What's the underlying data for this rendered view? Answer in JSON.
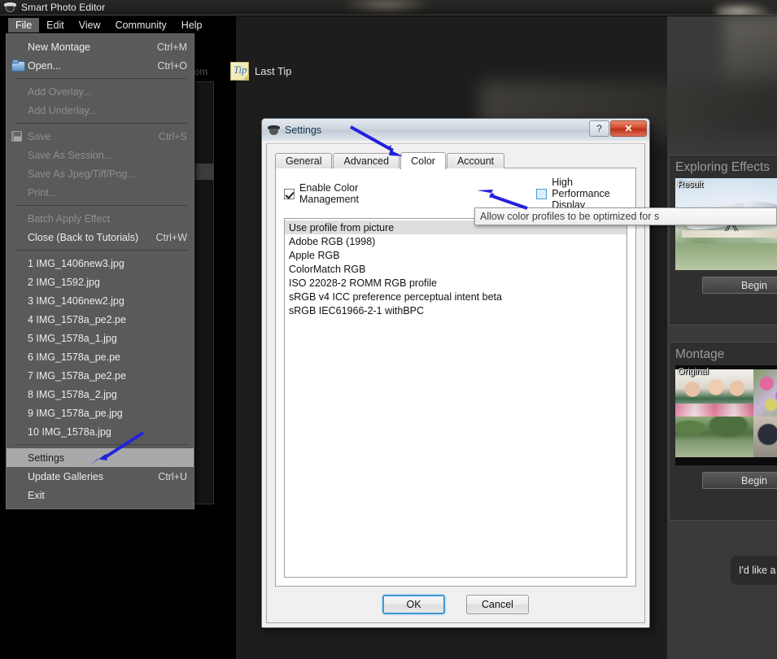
{
  "app": {
    "title": "Smart Photo Editor",
    "icon": "camera-icon"
  },
  "menubar": {
    "items": [
      {
        "label": "File",
        "active": true
      },
      {
        "label": "Edit",
        "active": false
      },
      {
        "label": "View",
        "active": false
      },
      {
        "label": "Community",
        "active": false
      },
      {
        "label": "Help",
        "active": false
      }
    ]
  },
  "toolbar": {
    "zoom_label": "oom",
    "tip_icon_glyph": "Tip",
    "last_tip_label": "Last Tip"
  },
  "file_menu": {
    "groups": [
      {
        "items": [
          {
            "label": "New Montage",
            "accel": "Ctrl+M",
            "icon": "",
            "disabled": false
          },
          {
            "label": "Open...",
            "accel": "Ctrl+O",
            "icon": "folder-open-icon",
            "disabled": false
          }
        ]
      },
      {
        "items": [
          {
            "label": "Add Overlay...",
            "accel": "",
            "icon": "",
            "disabled": true
          },
          {
            "label": "Add Underlay...",
            "accel": "",
            "icon": "",
            "disabled": true
          }
        ]
      },
      {
        "items": [
          {
            "label": "Save",
            "accel": "Ctrl+S",
            "icon": "save-icon",
            "disabled": true
          },
          {
            "label": "Save As Session...",
            "accel": "",
            "icon": "",
            "disabled": true
          },
          {
            "label": "Save As Jpeg/Tiff/Png...",
            "accel": "",
            "icon": "",
            "disabled": true
          },
          {
            "label": "Print...",
            "accel": "",
            "icon": "",
            "disabled": true
          }
        ]
      },
      {
        "items": [
          {
            "label": "Batch Apply Effect",
            "accel": "",
            "icon": "",
            "disabled": true
          },
          {
            "label": "Close (Back to Tutorials)",
            "accel": "Ctrl+W",
            "icon": "",
            "disabled": false
          }
        ]
      },
      {
        "items": [
          {
            "label": "1 IMG_1406new3.jpg",
            "accel": "",
            "icon": "",
            "disabled": false
          },
          {
            "label": "2 IMG_1592.jpg",
            "accel": "",
            "icon": "",
            "disabled": false
          },
          {
            "label": "3 IMG_1406new2.jpg",
            "accel": "",
            "icon": "",
            "disabled": false
          },
          {
            "label": "4 IMG_1578a_pe2.pe",
            "accel": "",
            "icon": "",
            "disabled": false
          },
          {
            "label": "5 IMG_1578a_1.jpg",
            "accel": "",
            "icon": "",
            "disabled": false
          },
          {
            "label": "6 IMG_1578a_pe.pe",
            "accel": "",
            "icon": "",
            "disabled": false
          },
          {
            "label": "7 IMG_1578a_pe2.pe",
            "accel": "",
            "icon": "",
            "disabled": false
          },
          {
            "label": "8 IMG_1578a_2.jpg",
            "accel": "",
            "icon": "",
            "disabled": false
          },
          {
            "label": "9 IMG_1578a_pe.jpg",
            "accel": "",
            "icon": "",
            "disabled": false
          },
          {
            "label": "10 IMG_1578a.jpg",
            "accel": "",
            "icon": "",
            "disabled": false
          }
        ]
      },
      {
        "items": [
          {
            "label": "Settings",
            "accel": "",
            "icon": "",
            "disabled": false,
            "highlight": true
          },
          {
            "label": "Update Galleries",
            "accel": "Ctrl+U",
            "icon": "",
            "disabled": false
          },
          {
            "label": "Exit",
            "accel": "",
            "icon": "",
            "disabled": false
          }
        ]
      }
    ]
  },
  "dialog": {
    "title": "Settings",
    "icon": "camera-icon",
    "window_buttons": {
      "help": "?",
      "close": "✕"
    },
    "tabs": [
      {
        "label": "General",
        "selected": false
      },
      {
        "label": "Advanced",
        "selected": false
      },
      {
        "label": "Color",
        "selected": true
      },
      {
        "label": "Account",
        "selected": false
      }
    ],
    "checkboxes": [
      {
        "label": "Enable Color Management",
        "checked": true,
        "hover": false
      },
      {
        "label": "High Performance Display",
        "checked": false,
        "hover": true
      }
    ],
    "profiles": [
      {
        "label": "Use profile from picture",
        "selected": true
      },
      {
        "label": "Adobe RGB (1998)",
        "selected": false
      },
      {
        "label": "Apple RGB",
        "selected": false
      },
      {
        "label": "ColorMatch RGB",
        "selected": false
      },
      {
        "label": "ISO 22028-2 ROMM RGB profile",
        "selected": false
      },
      {
        "label": "sRGB v4 ICC preference perceptual intent beta",
        "selected": false
      },
      {
        "label": "sRGB IEC61966-2-1 withBPC",
        "selected": false
      }
    ],
    "buttons": {
      "ok": "OK",
      "cancel": "Cancel"
    }
  },
  "tooltip": {
    "text": "Allow color profiles to be optimized for s"
  },
  "side_panels": [
    {
      "title": "Exploring Effects",
      "thumb_badge": "Result",
      "button_label": "Begin"
    },
    {
      "title": "Montage",
      "thumb_badge": "Original",
      "button_label": "Begin"
    }
  ],
  "chat_bubble": {
    "text": "I'd like a"
  },
  "annotations": {
    "accent_color": "#2222dd",
    "arrows": [
      {
        "name": "arrow-to-color-tab"
      },
      {
        "name": "arrow-to-high-performance-checkbox"
      },
      {
        "name": "arrow-to-settings-menu-item"
      }
    ]
  }
}
